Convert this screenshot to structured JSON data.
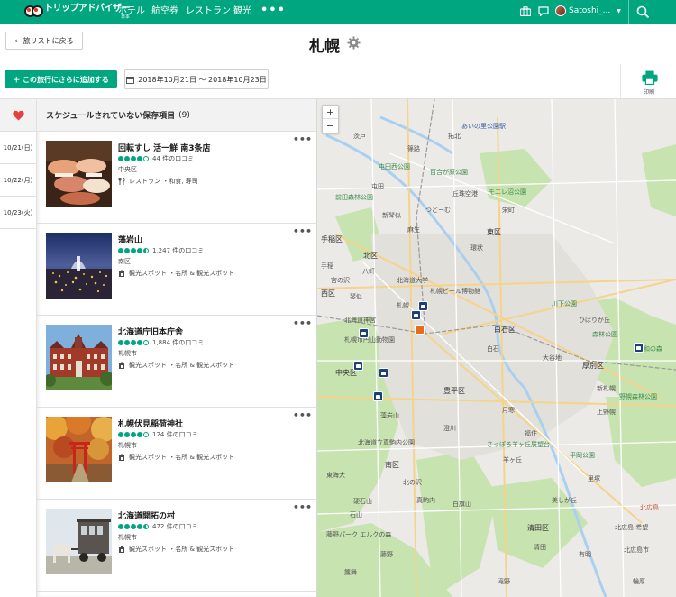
{
  "header": {
    "logo_text": "トリップアドバイザー",
    "logo_sub": "日本",
    "nav": [
      "ホテル",
      "航空券",
      "レストラン",
      "観光"
    ],
    "more": "•••",
    "user_name": "Satoshi_..."
  },
  "toolbar": {
    "back_label": "← 旅リストに戻る",
    "trip_title": "札幌",
    "add_label": "＋ この旅行にさらに追加する",
    "date_range": "2018年10月21日 〜 2018年10月23日",
    "print_label": "印刷"
  },
  "days": [
    "10/21(日)",
    "10/22(月)",
    "10/23(火)"
  ],
  "list": {
    "heading": "スケジュールされていない保存項目",
    "count": "(9)",
    "items": [
      {
        "name": "回転すし 活一鮮 南3条店",
        "reviews": "44 件の口コミ",
        "rating": 4,
        "region": "中央区",
        "category": "レストラン ・和食, 寿司",
        "icon": "fork-knife-icon"
      },
      {
        "name": "藻岩山",
        "reviews": "1,247 件の口コミ",
        "rating": 4.5,
        "region": "南区",
        "category": "観光スポット ・名所 & 観光スポット",
        "icon": "landmark-icon"
      },
      {
        "name": "北海道庁旧本庁舎",
        "reviews": "1,884 件の口コミ",
        "rating": 4,
        "region": "札幌市",
        "category": "観光スポット ・名所 & 観光スポット",
        "icon": "landmark-icon"
      },
      {
        "name": "札幌伏見稲荷神社",
        "reviews": "124 件の口コミ",
        "rating": 4,
        "region": "札幌市",
        "category": "観光スポット ・名所 & 観光スポット",
        "icon": "landmark-icon"
      },
      {
        "name": "北海道開拓の村",
        "reviews": "472 件の口コミ",
        "rating": 4.5,
        "region": "札幌市",
        "category": "観光スポット ・名所 & 観光スポット",
        "icon": "landmark-icon"
      }
    ]
  },
  "map": {
    "zoom_in": "+",
    "zoom_out": "−",
    "labels": {
      "l1": "あいの里公園駅",
      "l2": "拓北",
      "l3": "百合が原公園",
      "l4": "屯田西公園",
      "l5": "モエレ沼公園",
      "l6": "つどーむ",
      "l7": "東区",
      "l8": "北区",
      "l9": "札幌ビール博物館",
      "l10": "白石区",
      "l11": "中央区",
      "l12": "西区",
      "l13": "手稲区",
      "l14": "札幌",
      "l15": "豊平区",
      "l16": "厚別区",
      "l17": "南区",
      "l18": "清田区",
      "l19": "北広島市",
      "l20": "北広島",
      "l21": "森林公園",
      "l22": "野幌森林公園",
      "l23": "さっぽろ羊ヶ丘展望台",
      "l24": "北海道立真駒内公園",
      "l25": "藤野パーク エルクの森",
      "l26": "新琴似",
      "l27": "栄町",
      "l28": "丘珠空港",
      "l29": "宮の沢",
      "l30": "琴似",
      "l31": "札幌市円山動物園",
      "l32": "北海道大学",
      "l33": "川下公園",
      "l34": "白石",
      "l35": "上野幌",
      "l36": "大谷地",
      "l37": "平岡公園",
      "l38": "羊ヶ丘",
      "l39": "澄川",
      "l40": "真駒内",
      "l41": "石山",
      "l42": "藻岩山",
      "l43": "東海大",
      "l44": "硬石山",
      "l45": "白旗山",
      "l46": "清田",
      "l47": "北広島 希望",
      "l48": "新札幌",
      "l49": "ひばりが丘",
      "l50": "昭和の森",
      "l51": "北海道神宮",
      "l52": "環状",
      "l53": "麻生",
      "l54": "屯田",
      "l55": "篠路",
      "l56": "茨戸",
      "l57": "前田森林公園",
      "l58": "手稲",
      "l59": "八軒",
      "l60": "石狩",
      "l61": "北の沢",
      "l62": "藤野",
      "l63": "簾舞",
      "l64": "月寒",
      "l65": "福住",
      "l66": "美しが丘",
      "l67": "里塚",
      "l68": "有明",
      "l69": "滝野",
      "l70": "輪厚"
    }
  },
  "colors": {
    "brand": "#00a680",
    "heart": "#e5413f",
    "pin": "#1d3f7a",
    "restaurant_pin": "#e86a1a"
  }
}
